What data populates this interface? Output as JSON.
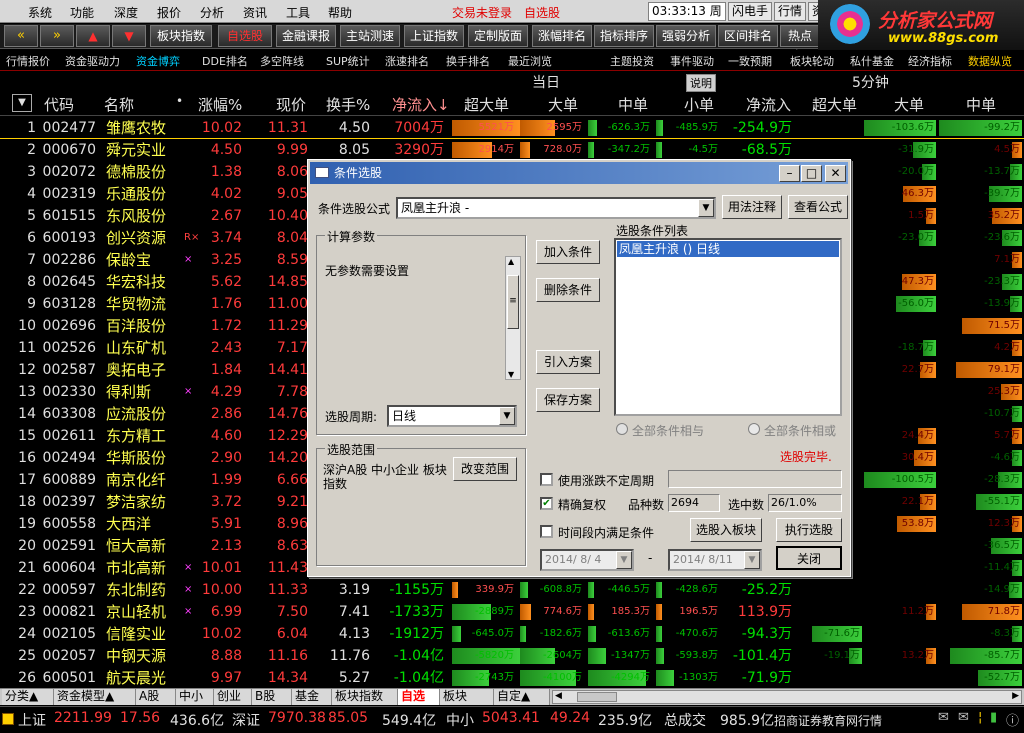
{
  "menu": {
    "items": [
      "系统",
      "功能",
      "深度",
      "报价",
      "分析",
      "资讯",
      "工具",
      "帮助"
    ],
    "warn1": "交易未登录",
    "warn2": "自选股",
    "clock": "03:33:13 周一",
    "right": [
      "闪电手",
      "行情",
      "资"
    ]
  },
  "logo": {
    "name": "分析家公式网",
    "url": "www.88gs.com"
  },
  "toolbar": {
    "buttons": [
      "板块指数",
      "自选股",
      "金融课报",
      "主站测速",
      "上证指数",
      "定制版面",
      "涨幅排名",
      "指标排序",
      "强弱分析",
      "区间排名",
      "热点板"
    ]
  },
  "tabs": [
    "行情报价",
    "资金驱动力",
    "资金博弈",
    "DDE排名",
    "多空阵线",
    "SUP统计",
    "涨速排名",
    "换手排名",
    "最近浏览",
    "主题投资",
    "事件驱动",
    "一致预期",
    "板块轮动",
    "私什基金",
    "经济指标",
    "数据纵览"
  ],
  "header": {
    "today": "当日",
    "explain": "说明",
    "fivemin": "5分钟",
    "cols": [
      "代码",
      "名称",
      "涨幅%",
      "现价",
      "换手%",
      "净流入↓",
      "超大单",
      "大单",
      "中单",
      "小单",
      "净流入",
      "超大单",
      "大单",
      "中单"
    ]
  },
  "rows": [
    {
      "idx": "1",
      "code": "002477",
      "name": "雏鹰农牧",
      "tag": "",
      "chg": "10.02",
      "price": "11.31",
      "turn": "4.50",
      "net": "7004万",
      "b1": "5521万",
      "b2": "2595万",
      "b3": "-626.3万",
      "b4": "-485.9万",
      "net2": "-254.9万",
      "r2": "-103.6万",
      "r3": "-99.2万"
    },
    {
      "idx": "2",
      "code": "000670",
      "name": "舜元实业",
      "tag": "",
      "chg": "4.50",
      "price": "9.99",
      "turn": "8.05",
      "net": "3290万",
      "b1": "2914万",
      "b2": "728.0万",
      "b3": "-347.2万",
      "b4": "-4.5万",
      "net2": "-68.5万",
      "r2": "-31.9万",
      "r3": "4.5万"
    },
    {
      "idx": "3",
      "code": "002072",
      "name": "德棉股份",
      "tag": "",
      "chg": "1.38",
      "price": "8.06",
      "turn": "",
      "net": "",
      "b1": "",
      "b2": "",
      "b3": "",
      "b4": "",
      "net2": "",
      "r2": "-20.0万",
      "r3": "-13.7万"
    },
    {
      "idx": "4",
      "code": "002319",
      "name": "乐通股份",
      "tag": "",
      "chg": "4.02",
      "price": "9.05",
      "turn": "",
      "net": "",
      "b1": "",
      "b2": "",
      "b3": "",
      "b4": "",
      "net2": "",
      "r2": "46.3万",
      "r3": "-39.7万"
    },
    {
      "idx": "5",
      "code": "601515",
      "name": "东风股份",
      "tag": "",
      "chg": "2.67",
      "price": "10.40",
      "turn": "",
      "net": "",
      "b1": "",
      "b2": "",
      "b3": "",
      "b4": "",
      "net2": "",
      "r2": "1.5万",
      "r3": "35.2万"
    },
    {
      "idx": "6",
      "code": "600193",
      "name": "创兴资源",
      "tag": "R×",
      "chg": "3.74",
      "price": "8.04",
      "turn": "",
      "net": "",
      "b1": "",
      "b2": "",
      "b3": "",
      "b4": "",
      "net2": "",
      "r2": "-23.0万",
      "r3": "-23.6万"
    },
    {
      "idx": "7",
      "code": "002286",
      "name": "保龄宝",
      "tag": "×",
      "chg": "3.25",
      "price": "8.59",
      "turn": "",
      "net": "",
      "b1": "",
      "b2": "",
      "b3": "",
      "b4": "",
      "net2": "",
      "r2": "",
      "r3": "7.1万"
    },
    {
      "idx": "8",
      "code": "002645",
      "name": "华宏科技",
      "tag": "",
      "chg": "5.62",
      "price": "14.85",
      "turn": "",
      "net": "",
      "b1": "",
      "b2": "",
      "b3": "",
      "b4": "",
      "net2": "",
      "r2": "47.3万",
      "r3": "-23.3万"
    },
    {
      "idx": "9",
      "code": "603128",
      "name": "华贸物流",
      "tag": "",
      "chg": "1.76",
      "price": "11.00",
      "turn": "",
      "net": "",
      "b1": "",
      "b2": "",
      "b3": "",
      "b4": "",
      "net2": "",
      "r2": "-56.0万",
      "r3": "-13.9万"
    },
    {
      "idx": "10",
      "code": "002696",
      "name": "百洋股份",
      "tag": "",
      "chg": "1.72",
      "price": "11.29",
      "turn": "",
      "net": "",
      "b1": "",
      "b2": "",
      "b3": "",
      "b4": "",
      "net2": "",
      "r2": "",
      "r3": "71.5万"
    },
    {
      "idx": "11",
      "code": "002526",
      "name": "山东矿机",
      "tag": "",
      "chg": "2.43",
      "price": "7.17",
      "turn": "",
      "net": "",
      "b1": "",
      "b2": "",
      "b3": "",
      "b4": "",
      "net2": "",
      "r2": "-18.7万",
      "r3": "4.2万"
    },
    {
      "idx": "12",
      "code": "002587",
      "name": "奥拓电子",
      "tag": "",
      "chg": "1.84",
      "price": "14.41",
      "turn": "",
      "net": "",
      "b1": "",
      "b2": "",
      "b3": "",
      "b4": "",
      "net2": "",
      "r2": "22.7万",
      "r3": "79.1万"
    },
    {
      "idx": "13",
      "code": "002330",
      "name": "得利斯",
      "tag": "×",
      "chg": "4.29",
      "price": "7.78",
      "turn": "",
      "net": "",
      "b1": "",
      "b2": "",
      "b3": "",
      "b4": "",
      "net2": "",
      "r2": "",
      "r3": "25.3万"
    },
    {
      "idx": "14",
      "code": "603308",
      "name": "应流股份",
      "tag": "",
      "chg": "2.86",
      "price": "14.76",
      "turn": "",
      "net": "",
      "b1": "",
      "b2": "",
      "b3": "",
      "b4": "",
      "net2": "",
      "r2": "",
      "r3": "-10.7万"
    },
    {
      "idx": "15",
      "code": "002611",
      "name": "东方精工",
      "tag": "",
      "chg": "4.60",
      "price": "12.29",
      "turn": "",
      "net": "",
      "b1": "",
      "b2": "",
      "b3": "",
      "b4": "",
      "net2": "",
      "r2": "24.4万",
      "r3": "5.7万"
    },
    {
      "idx": "16",
      "code": "002494",
      "name": "华斯股份",
      "tag": "",
      "chg": "2.90",
      "price": "14.20",
      "turn": "",
      "net": "",
      "b1": "",
      "b2": "",
      "b3": "",
      "b4": "",
      "net2": "",
      "r2": "30.4万",
      "r3": "-4.6万"
    },
    {
      "idx": "17",
      "code": "600889",
      "name": "南京化纤",
      "tag": "",
      "chg": "1.99",
      "price": "6.66",
      "turn": "",
      "net": "",
      "b1": "",
      "b2": "",
      "b3": "",
      "b4": "",
      "net2": "",
      "r2": "-100.5万",
      "r3": "-28.3万"
    },
    {
      "idx": "18",
      "code": "002397",
      "name": "梦洁家纺",
      "tag": "",
      "chg": "3.72",
      "price": "9.21",
      "turn": "",
      "net": "",
      "b1": "",
      "b2": "",
      "b3": "",
      "b4": "",
      "net2": "",
      "r2": "22.1万",
      "r3": "-55.1万"
    },
    {
      "idx": "19",
      "code": "600558",
      "name": "大西洋",
      "tag": "",
      "chg": "5.91",
      "price": "8.96",
      "turn": "",
      "net": "",
      "b1": "",
      "b2": "",
      "b3": "",
      "b4": "",
      "net2": "",
      "r2": "53.8万",
      "r3": "12.3万"
    },
    {
      "idx": "20",
      "code": "002591",
      "name": "恒大高新",
      "tag": "",
      "chg": "2.13",
      "price": "8.63",
      "turn": "",
      "net": "",
      "b1": "",
      "b2": "",
      "b3": "",
      "b4": "",
      "net2": "",
      "r2": "",
      "r3": "-36.5万"
    },
    {
      "idx": "21",
      "code": "600604",
      "name": "市北高新",
      "tag": "×",
      "chg": "10.01",
      "price": "11.43",
      "turn": "",
      "net": "",
      "b1": "",
      "b2": "",
      "b3": "",
      "b4": "",
      "net2": "",
      "r2": "",
      "r3": "-11.4万"
    },
    {
      "idx": "22",
      "code": "000597",
      "name": "东北制药",
      "tag": "×",
      "chg": "10.00",
      "price": "11.33",
      "turn": "3.19",
      "net": "-1155万",
      "b1": "339.9万",
      "b2": "-608.8万",
      "b3": "-446.5万",
      "b4": "-428.6万",
      "net2": "-25.2万",
      "r2": "",
      "r3": "-14.9万"
    },
    {
      "idx": "23",
      "code": "000821",
      "name": "京山轻机",
      "tag": "×",
      "chg": "6.99",
      "price": "7.50",
      "turn": "7.41",
      "net": "-1733万",
      "b1": "-2889万",
      "b2": "774.6万",
      "b3": "185.3万",
      "b4": "196.5万",
      "net2": "113.9万",
      "r2": "11.2万",
      "r3": "71.8万"
    },
    {
      "idx": "24",
      "code": "002105",
      "name": "信隆实业",
      "tag": "",
      "chg": "10.02",
      "price": "6.04",
      "turn": "4.13",
      "net": "-1912万",
      "b1": "-645.0万",
      "b2": "-182.6万",
      "b3": "-613.6万",
      "b4": "-470.6万",
      "net2": "-94.3万",
      "r1": "-71.6万",
      "r2": "",
      "r3": "-8.3万"
    },
    {
      "idx": "25",
      "code": "002057",
      "name": "中钢天源",
      "tag": "",
      "chg": "8.88",
      "price": "11.16",
      "turn": "11.76",
      "net": "-1.04亿",
      "b1": "-5820万",
      "b2": "-2604万",
      "b3": "-1347万",
      "b4": "-593.8万",
      "net2": "-101.4万",
      "r1": "-19.1万",
      "r2": "13.2万",
      "r3": "-85.7万"
    },
    {
      "idx": "26",
      "code": "600501",
      "name": "航天晨光",
      "tag": "",
      "chg": "9.97",
      "price": "14.34",
      "turn": "5.27",
      "net": "-1.04亿",
      "b1": "-2743万",
      "b2": "-4100万",
      "b3": "-4294万",
      "b4": "-1303万",
      "net2": "-71.9万",
      "r2": "",
      "r3": "-52.7万"
    }
  ],
  "bottom_tabs": [
    "分类▲",
    "资金模型▲",
    "A股",
    "中小",
    "创业",
    "B股",
    "基金",
    "板块指数",
    "自选",
    "板块",
    "自定▲"
  ],
  "status": {
    "sh_label": "上证",
    "sh": "2211.99",
    "sh_chg": "17.56",
    "sh_amt": "436.6亿",
    "sz_label": "深证",
    "sz": "7970.38",
    "sz_chg": "85.05",
    "sz_amt": "549.4亿",
    "zx_label": "中小",
    "zx": "5043.41",
    "zx_chg": "49.24",
    "zx_amt": "235.9亿",
    "total_label": "总成交",
    "total": "985.9亿",
    "broker": "招商证券教育网行情"
  },
  "dialog": {
    "title": "条件选股",
    "formula_label": "条件选股公式",
    "formula_value": "凤凰主升浪 -",
    "usage_btn": "用法注释",
    "view_btn": "查看公式",
    "params_group": "计算参数",
    "params_text": "无参数需要设置",
    "period_label": "选股周期:",
    "period_value": "日线",
    "add_btn": "加入条件",
    "del_btn": "删除条件",
    "import_btn": "引入方案",
    "save_btn": "保存方案",
    "list_label": "选股条件列表",
    "list_item": "凤凰主升浪  () 日线",
    "and_label": "全部条件相与",
    "or_label": "全部条件相或",
    "range_group": "选股范围",
    "range_text": "深沪A股 中小企业 板块指数",
    "change_range_btn": "改变范围",
    "done_text": "选股完毕.",
    "uncertain_label": "使用涨跌不定周期",
    "exact_label": "精确复权",
    "count_label": "品种数",
    "count_value": "2694",
    "selected_label": "选中数",
    "selected_value": "26/1.0%",
    "interval_label": "时间段内满足条件",
    "to_block_btn": "选股入板块",
    "run_btn": "执行选股",
    "date_from": "2014/ 8/ 4",
    "date_sep": "-",
    "date_to": "2014/ 8/11",
    "close_btn": "关闭"
  }
}
